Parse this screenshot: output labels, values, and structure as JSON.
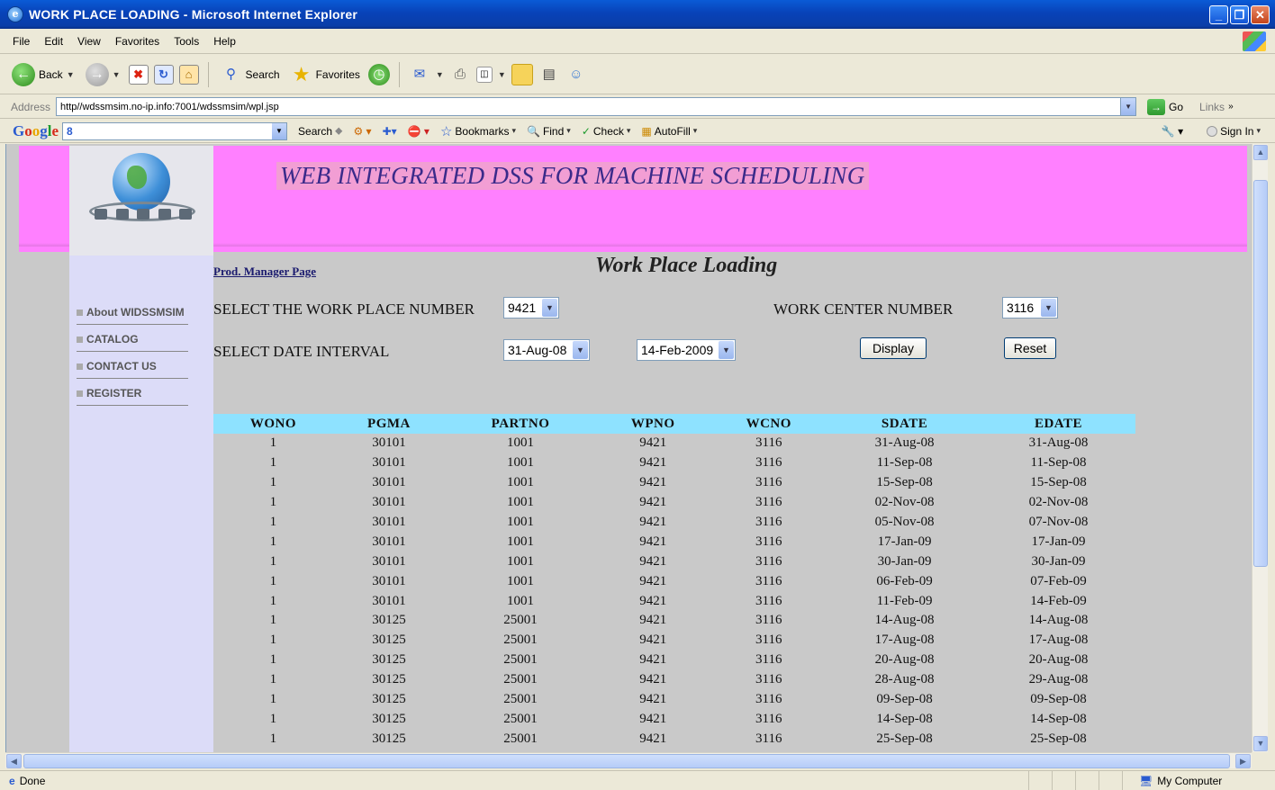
{
  "window": {
    "title": "WORK PLACE LOADING - Microsoft Internet Explorer",
    "menus": [
      "File",
      "Edit",
      "View",
      "Favorites",
      "Tools",
      "Help"
    ]
  },
  "toolbar": {
    "back": "Back",
    "search": "Search",
    "favorites": "Favorites"
  },
  "address": {
    "label": "Address",
    "url": "http//wdssmsim.no-ip.info:7001/wdssmsim/wpl.jsp",
    "go": "Go",
    "links": "Links"
  },
  "google": {
    "logo": "Google",
    "search_value": "8",
    "search": "Search",
    "bookmarks": "Bookmarks",
    "find": "Find",
    "check": "Check",
    "autofill": "AutoFill",
    "signin": "Sign In"
  },
  "page": {
    "banner_title": "WEB INTEGRATED DSS FOR MACHINE SCHEDULING",
    "prod_link": "Prod. Manager Page",
    "heading": "Work Place Loading",
    "nav": [
      "About WIDSSMSIM",
      "CATALOG",
      "CONTACT US",
      "REGISTER"
    ],
    "form": {
      "wp_label": "SELECT THE WORK PLACE NUMBER",
      "wp_value": "9421",
      "wc_label": "WORK CENTER NUMBER",
      "wc_value": "3116",
      "date_label": "SELECT DATE INTERVAL",
      "date_from": "31-Aug-08",
      "date_to": "14-Feb-2009",
      "display": "Display",
      "reset": "Reset"
    },
    "table": {
      "columns": [
        "WONO",
        "PGMA",
        "PARTNO",
        "WPNO",
        "WCNO",
        "SDATE",
        "EDATE"
      ],
      "rows": [
        [
          "1",
          "30101",
          "1001",
          "9421",
          "3116",
          "31-Aug-08",
          "31-Aug-08"
        ],
        [
          "1",
          "30101",
          "1001",
          "9421",
          "3116",
          "11-Sep-08",
          "11-Sep-08"
        ],
        [
          "1",
          "30101",
          "1001",
          "9421",
          "3116",
          "15-Sep-08",
          "15-Sep-08"
        ],
        [
          "1",
          "30101",
          "1001",
          "9421",
          "3116",
          "02-Nov-08",
          "02-Nov-08"
        ],
        [
          "1",
          "30101",
          "1001",
          "9421",
          "3116",
          "05-Nov-08",
          "07-Nov-08"
        ],
        [
          "1",
          "30101",
          "1001",
          "9421",
          "3116",
          "17-Jan-09",
          "17-Jan-09"
        ],
        [
          "1",
          "30101",
          "1001",
          "9421",
          "3116",
          "30-Jan-09",
          "30-Jan-09"
        ],
        [
          "1",
          "30101",
          "1001",
          "9421",
          "3116",
          "06-Feb-09",
          "07-Feb-09"
        ],
        [
          "1",
          "30101",
          "1001",
          "9421",
          "3116",
          "11-Feb-09",
          "14-Feb-09"
        ],
        [
          "1",
          "30125",
          "25001",
          "9421",
          "3116",
          "14-Aug-08",
          "14-Aug-08"
        ],
        [
          "1",
          "30125",
          "25001",
          "9421",
          "3116",
          "17-Aug-08",
          "17-Aug-08"
        ],
        [
          "1",
          "30125",
          "25001",
          "9421",
          "3116",
          "20-Aug-08",
          "20-Aug-08"
        ],
        [
          "1",
          "30125",
          "25001",
          "9421",
          "3116",
          "28-Aug-08",
          "29-Aug-08"
        ],
        [
          "1",
          "30125",
          "25001",
          "9421",
          "3116",
          "09-Sep-08",
          "09-Sep-08"
        ],
        [
          "1",
          "30125",
          "25001",
          "9421",
          "3116",
          "14-Sep-08",
          "14-Sep-08"
        ],
        [
          "1",
          "30125",
          "25001",
          "9421",
          "3116",
          "25-Sep-08",
          "25-Sep-08"
        ]
      ]
    }
  },
  "status": {
    "text": "Done",
    "zone": "My Computer"
  },
  "colors": {
    "banner": "#ff80ff",
    "table_header": "#8ee2ff",
    "nav_bg": "#dcdcf8",
    "content_bg": "#c9c9c9"
  }
}
